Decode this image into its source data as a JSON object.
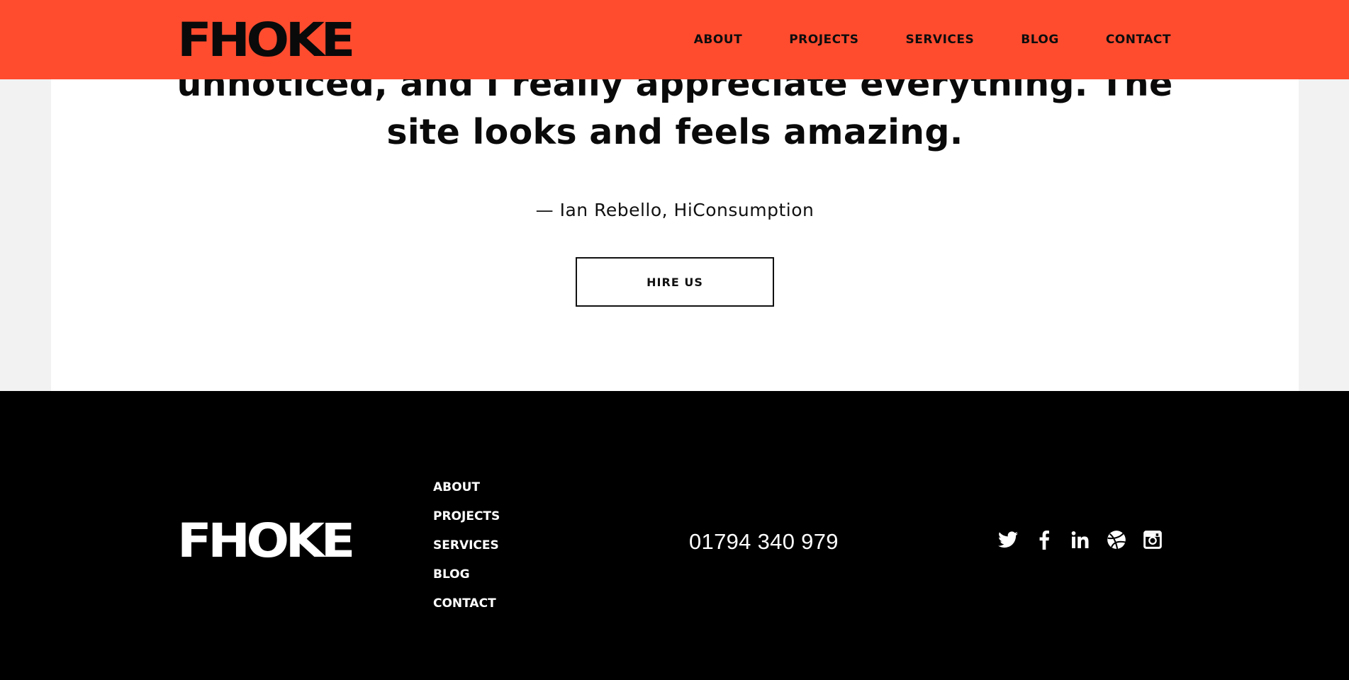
{
  "header": {
    "logo": "FHOKE",
    "nav": [
      "ABOUT",
      "PROJECTS",
      "SERVICES",
      "BLOG",
      "CONTACT"
    ],
    "background_color": "#ff4c2f"
  },
  "testimonial": {
    "quote_lines": [
      "unnoticed, and I really appreciate everything. The",
      "site looks and feels amazing."
    ],
    "attribution": "— Ian Rebello, HiConsumption",
    "cta_label": "HIRE US"
  },
  "footer": {
    "logo": "FHOKE",
    "nav": [
      "ABOUT",
      "PROJECTS",
      "SERVICES",
      "BLOG",
      "CONTACT"
    ],
    "phone": "01794 340 979",
    "social_icons": [
      "twitter-icon",
      "facebook-icon",
      "linkedin-icon",
      "dribbble-icon",
      "instagram-icon"
    ],
    "background_color": "#000000"
  }
}
